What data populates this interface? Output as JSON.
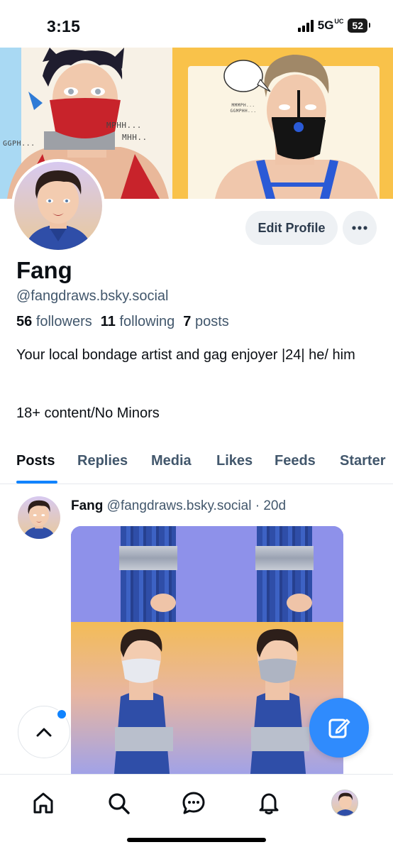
{
  "status_bar": {
    "time": "3:15",
    "network": "5G",
    "network_sub": "UC",
    "battery": "52"
  },
  "banner": {
    "sfx_left": "GGPH...",
    "sfx_mid_1": "MPHH...",
    "sfx_mid_2": "MHH..",
    "speech_bubble": "MMMPH... GGMPHH..."
  },
  "profile": {
    "display_name": "Fang",
    "handle": "@fangdraws.bsky.social",
    "followers_count": "56",
    "followers_label": "followers",
    "following_count": "11",
    "following_label": "following",
    "posts_count": "7",
    "posts_label": "posts",
    "bio_line1": "Your local bondage artist and gag enjoyer |24| he/ him",
    "bio_line2": "18+ content/No Minors",
    "edit_label": "Edit Profile",
    "more_label": "···"
  },
  "tabs": [
    {
      "label": "Posts",
      "active": true
    },
    {
      "label": "Replies",
      "active": false
    },
    {
      "label": "Media",
      "active": false
    },
    {
      "label": "Likes",
      "active": false
    },
    {
      "label": "Feeds",
      "active": false
    },
    {
      "label": "Starter",
      "active": false
    }
  ],
  "post": {
    "author_name": "Fang",
    "author_handle": "@fangdraws.bsky.social",
    "separator": "·",
    "age": "20d"
  },
  "nav": {
    "items": [
      "home-icon",
      "search-icon",
      "chat-icon",
      "bell-icon",
      "profile-avatar"
    ]
  },
  "colors": {
    "accent": "#1083fe",
    "compose": "#2f8bfd",
    "muted_text": "#42576c",
    "button_bg": "#eef1f4"
  }
}
